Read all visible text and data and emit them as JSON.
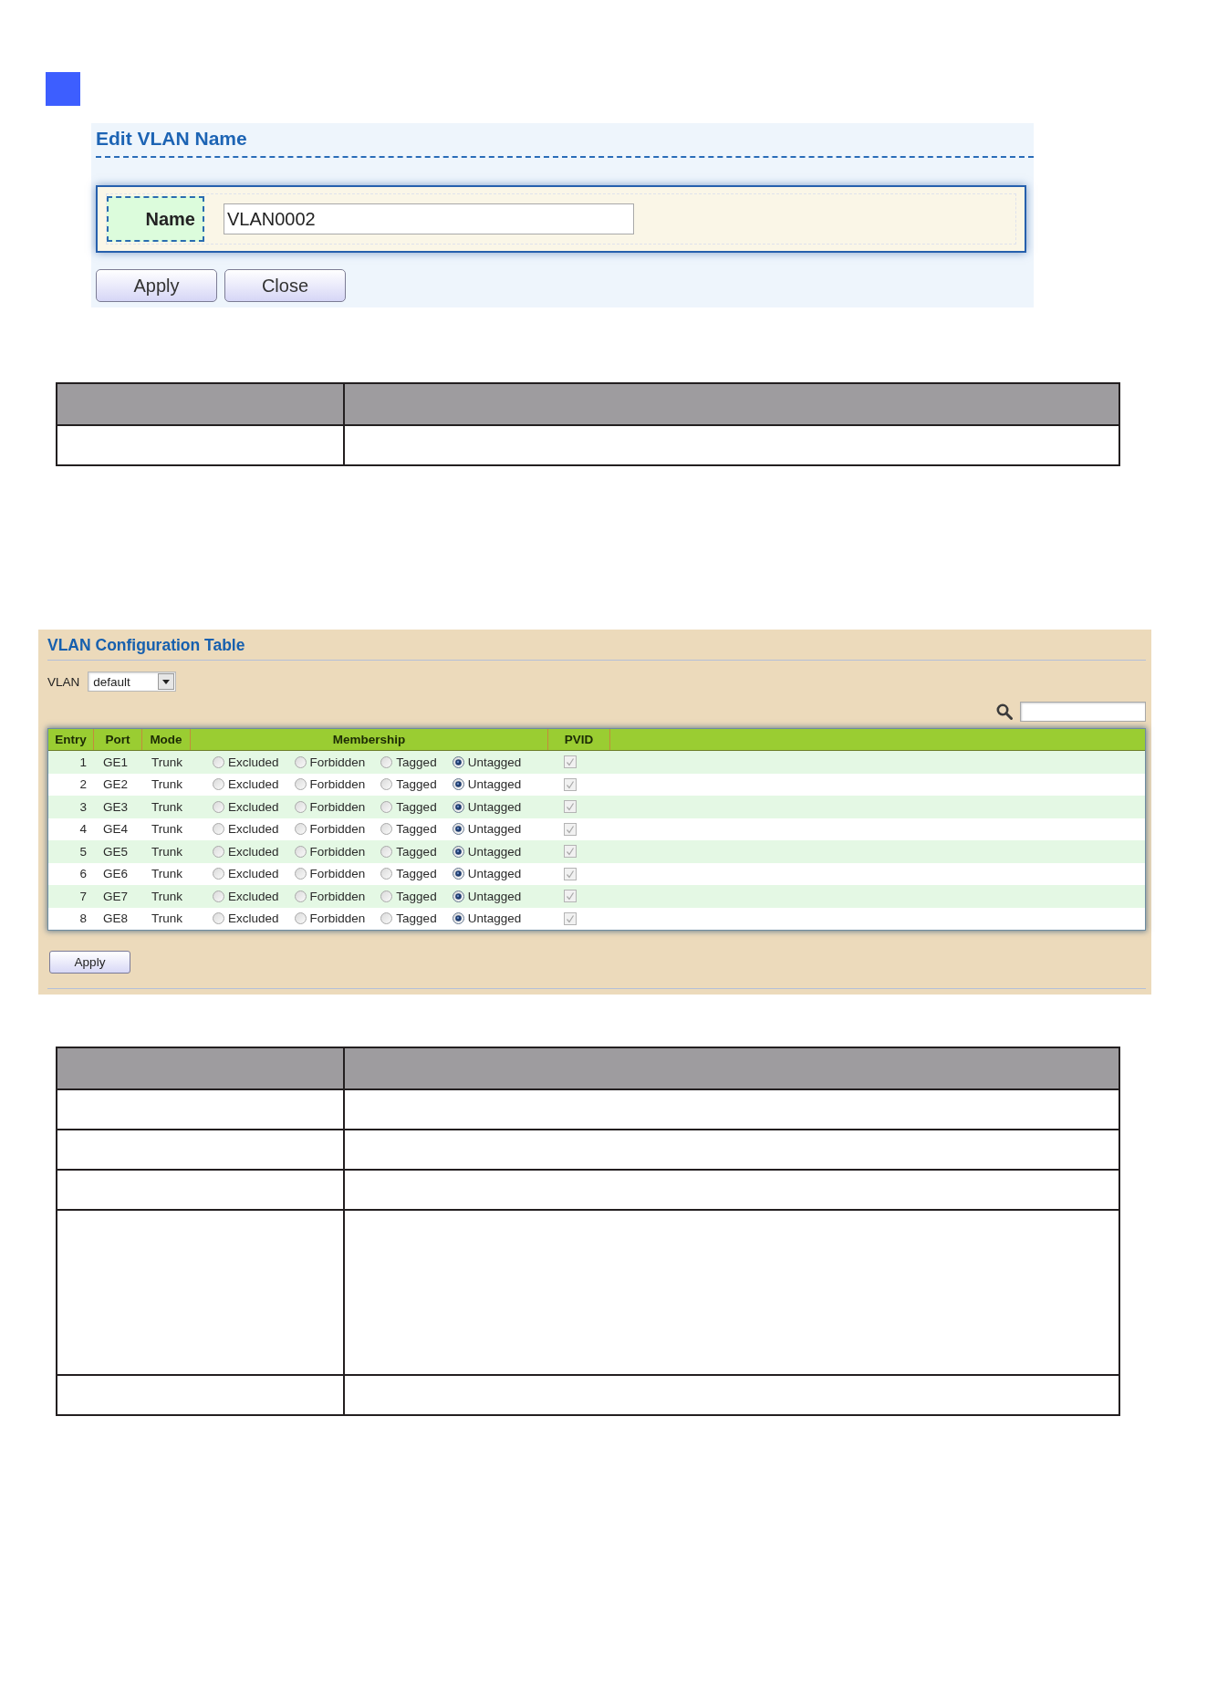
{
  "edit_vlan_name": {
    "title": "Edit VLAN Name",
    "fields": [
      {
        "label": "Name",
        "value": "VLAN0002"
      }
    ],
    "buttons": [
      "Apply",
      "Close"
    ]
  },
  "table_1": {
    "rows": [
      {
        "kind": "short"
      }
    ]
  },
  "vlan_configuration_table": {
    "title": "VLAN Configuration Table",
    "vlan_select": {
      "label": "VLAN",
      "value": "default"
    },
    "columns": [
      "Entry",
      "Port",
      "Mode",
      "Membership",
      "PVID"
    ],
    "rows": [
      {
        "entry": "1",
        "port": "GE1",
        "mode": "Trunk",
        "membership": [
          {
            "label": "Excluded",
            "selected": false
          },
          {
            "label": "Forbidden",
            "selected": false
          },
          {
            "label": "Tagged",
            "selected": false
          },
          {
            "label": "Untagged",
            "selected": true
          }
        ],
        "pvid": {
          "checked": true,
          "disabled": true
        }
      },
      {
        "entry": "2",
        "port": "GE2",
        "mode": "Trunk",
        "membership": [
          {
            "label": "Excluded",
            "selected": false
          },
          {
            "label": "Forbidden",
            "selected": false
          },
          {
            "label": "Tagged",
            "selected": false
          },
          {
            "label": "Untagged",
            "selected": true
          }
        ],
        "pvid": {
          "checked": true,
          "disabled": true
        }
      },
      {
        "entry": "3",
        "port": "GE3",
        "mode": "Trunk",
        "membership": [
          {
            "label": "Excluded",
            "selected": false
          },
          {
            "label": "Forbidden",
            "selected": false
          },
          {
            "label": "Tagged",
            "selected": false
          },
          {
            "label": "Untagged",
            "selected": true
          }
        ],
        "pvid": {
          "checked": true,
          "disabled": true
        }
      },
      {
        "entry": "4",
        "port": "GE4",
        "mode": "Trunk",
        "membership": [
          {
            "label": "Excluded",
            "selected": false
          },
          {
            "label": "Forbidden",
            "selected": false
          },
          {
            "label": "Tagged",
            "selected": false
          },
          {
            "label": "Untagged",
            "selected": true
          }
        ],
        "pvid": {
          "checked": true,
          "disabled": true
        }
      },
      {
        "entry": "5",
        "port": "GE5",
        "mode": "Trunk",
        "membership": [
          {
            "label": "Excluded",
            "selected": false
          },
          {
            "label": "Forbidden",
            "selected": false
          },
          {
            "label": "Tagged",
            "selected": false
          },
          {
            "label": "Untagged",
            "selected": true
          }
        ],
        "pvid": {
          "checked": true,
          "disabled": true
        }
      },
      {
        "entry": "6",
        "port": "GE6",
        "mode": "Trunk",
        "membership": [
          {
            "label": "Excluded",
            "selected": false
          },
          {
            "label": "Forbidden",
            "selected": false
          },
          {
            "label": "Tagged",
            "selected": false
          },
          {
            "label": "Untagged",
            "selected": true
          }
        ],
        "pvid": {
          "checked": true,
          "disabled": true
        }
      },
      {
        "entry": "7",
        "port": "GE7",
        "mode": "Trunk",
        "membership": [
          {
            "label": "Excluded",
            "selected": false
          },
          {
            "label": "Forbidden",
            "selected": false
          },
          {
            "label": "Tagged",
            "selected": false
          },
          {
            "label": "Untagged",
            "selected": true
          }
        ],
        "pvid": {
          "checked": true,
          "disabled": true
        }
      },
      {
        "entry": "8",
        "port": "GE8",
        "mode": "Trunk",
        "membership": [
          {
            "label": "Excluded",
            "selected": false
          },
          {
            "label": "Forbidden",
            "selected": false
          },
          {
            "label": "Tagged",
            "selected": false
          },
          {
            "label": "Untagged",
            "selected": true
          }
        ],
        "pvid": {
          "checked": true,
          "disabled": true
        }
      }
    ],
    "buttons": [
      "Apply"
    ]
  },
  "table_2": {
    "rows": [
      {
        "kind": "short"
      },
      {
        "kind": "short"
      },
      {
        "kind": "short"
      },
      {
        "kind": "tall"
      },
      {
        "kind": "short"
      }
    ]
  }
}
